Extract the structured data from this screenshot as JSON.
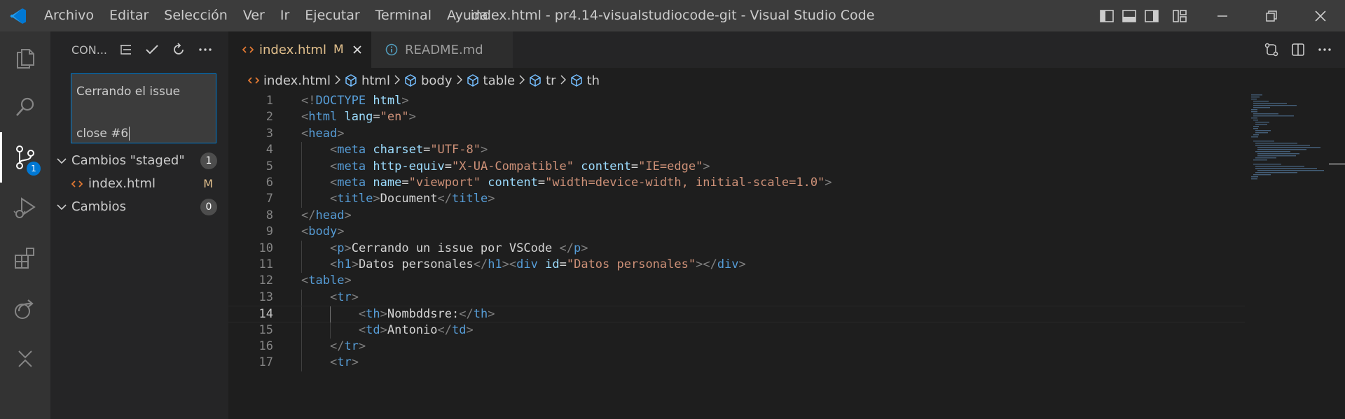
{
  "titlebar": {
    "menu": [
      "Archivo",
      "Editar",
      "Selección",
      "Ver",
      "Ir",
      "Ejecutar",
      "Terminal",
      "Ayuda"
    ],
    "title": "index.html - pr4.14-visualstudiocode-git - Visual Studio Code"
  },
  "activitybar": {
    "items": [
      "explorer-icon",
      "search-icon",
      "source-control-icon",
      "run-debug-icon",
      "extensions-icon",
      "remote-icon",
      "close-icon"
    ],
    "source_control_badge": "1"
  },
  "sidebar": {
    "title": "CON...",
    "commit_message": {
      "line1": "Cerrando el issue",
      "line2": "close #6"
    },
    "staged": {
      "label": "Cambios \"staged\"",
      "count": "1"
    },
    "staged_files": [
      {
        "name": "index.html",
        "status": "M"
      }
    ],
    "changes": {
      "label": "Cambios",
      "count": "0"
    }
  },
  "tabs": [
    {
      "label": "index.html",
      "status": "M",
      "active": true
    },
    {
      "label": "README.md",
      "active": false
    }
  ],
  "breadcrumb": [
    "index.html",
    "html",
    "body",
    "table",
    "tr",
    "th"
  ],
  "code": {
    "line_numbers": [
      "1",
      "2",
      "3",
      "4",
      "5",
      "6",
      "7",
      "8",
      "9",
      "10",
      "11",
      "12",
      "13",
      "14",
      "15",
      "16",
      "17"
    ],
    "current_line": 14,
    "lines": [
      [
        [
          "p",
          "<!"
        ],
        [
          "d",
          "DOCTYPE"
        ],
        [
          "t",
          " "
        ],
        [
          "a",
          "html"
        ],
        [
          "p",
          ">"
        ]
      ],
      [
        [
          "p",
          "<"
        ],
        [
          "g",
          "html"
        ],
        [
          "t",
          " "
        ],
        [
          "a",
          "lang"
        ],
        [
          "t",
          "="
        ],
        [
          "s",
          "\"en\""
        ],
        [
          "p",
          ">"
        ]
      ],
      [
        [
          "p",
          "<"
        ],
        [
          "g",
          "head"
        ],
        [
          "p",
          ">"
        ]
      ],
      [
        [
          "t",
          "    "
        ],
        [
          "p",
          "<"
        ],
        [
          "g",
          "meta"
        ],
        [
          "t",
          " "
        ],
        [
          "a",
          "charset"
        ],
        [
          "t",
          "="
        ],
        [
          "s",
          "\"UTF-8\""
        ],
        [
          "p",
          ">"
        ]
      ],
      [
        [
          "t",
          "    "
        ],
        [
          "p",
          "<"
        ],
        [
          "g",
          "meta"
        ],
        [
          "t",
          " "
        ],
        [
          "a",
          "http-equiv"
        ],
        [
          "t",
          "="
        ],
        [
          "s",
          "\"X-UA-Compatible\""
        ],
        [
          "t",
          " "
        ],
        [
          "a",
          "content"
        ],
        [
          "t",
          "="
        ],
        [
          "s",
          "\"IE=edge\""
        ],
        [
          "p",
          ">"
        ]
      ],
      [
        [
          "t",
          "    "
        ],
        [
          "p",
          "<"
        ],
        [
          "g",
          "meta"
        ],
        [
          "t",
          " "
        ],
        [
          "a",
          "name"
        ],
        [
          "t",
          "="
        ],
        [
          "s",
          "\"viewport\""
        ],
        [
          "t",
          " "
        ],
        [
          "a",
          "content"
        ],
        [
          "t",
          "="
        ],
        [
          "s",
          "\"width=device-width, initial-scale=1.0\""
        ],
        [
          "p",
          ">"
        ]
      ],
      [
        [
          "t",
          "    "
        ],
        [
          "p",
          "<"
        ],
        [
          "g",
          "title"
        ],
        [
          "p",
          ">"
        ],
        [
          "t",
          "Document"
        ],
        [
          "p",
          "</"
        ],
        [
          "g",
          "title"
        ],
        [
          "p",
          ">"
        ]
      ],
      [
        [
          "p",
          "</"
        ],
        [
          "g",
          "head"
        ],
        [
          "p",
          ">"
        ]
      ],
      [
        [
          "p",
          "<"
        ],
        [
          "g",
          "body"
        ],
        [
          "p",
          ">"
        ]
      ],
      [
        [
          "t",
          "    "
        ],
        [
          "p",
          "<"
        ],
        [
          "g",
          "p"
        ],
        [
          "p",
          ">"
        ],
        [
          "t",
          "Cerrando un issue por VSCode "
        ],
        [
          "p",
          "</"
        ],
        [
          "g",
          "p"
        ],
        [
          "p",
          ">"
        ]
      ],
      [
        [
          "t",
          "    "
        ],
        [
          "p",
          "<"
        ],
        [
          "g",
          "h1"
        ],
        [
          "p",
          ">"
        ],
        [
          "t",
          "Datos personales"
        ],
        [
          "p",
          "</"
        ],
        [
          "g",
          "h1"
        ],
        [
          "p",
          "><"
        ],
        [
          "g",
          "div"
        ],
        [
          "t",
          " "
        ],
        [
          "a",
          "id"
        ],
        [
          "t",
          "="
        ],
        [
          "s",
          "\"Datos personales\""
        ],
        [
          "p",
          "></"
        ],
        [
          "g",
          "div"
        ],
        [
          "p",
          ">"
        ]
      ],
      [
        [
          "p",
          "<"
        ],
        [
          "g",
          "table"
        ],
        [
          "p",
          ">"
        ]
      ],
      [
        [
          "t",
          "    "
        ],
        [
          "p",
          "<"
        ],
        [
          "g",
          "tr"
        ],
        [
          "p",
          ">"
        ]
      ],
      [
        [
          "t",
          "        "
        ],
        [
          "p",
          "<"
        ],
        [
          "g",
          "th"
        ],
        [
          "p",
          ">"
        ],
        [
          "t",
          "Nombddsre:"
        ],
        [
          "p",
          "</"
        ],
        [
          "g",
          "th"
        ],
        [
          "p",
          ">"
        ]
      ],
      [
        [
          "t",
          "        "
        ],
        [
          "p",
          "<"
        ],
        [
          "g",
          "td"
        ],
        [
          "p",
          ">"
        ],
        [
          "t",
          "Antonio"
        ],
        [
          "p",
          "</"
        ],
        [
          "g",
          "td"
        ],
        [
          "p",
          ">"
        ]
      ],
      [
        [
          "t",
          "    "
        ],
        [
          "p",
          "</"
        ],
        [
          "g",
          "tr"
        ],
        [
          "p",
          ">"
        ]
      ],
      [
        [
          "t",
          "    "
        ],
        [
          "p",
          "<"
        ],
        [
          "g",
          "tr"
        ],
        [
          "p",
          ">"
        ]
      ]
    ]
  },
  "colors": {
    "accent": "#007fd4",
    "modified": "#e2c08d",
    "tag": "#569cd6",
    "attribute": "#9cdcfe",
    "string": "#ce9178"
  }
}
